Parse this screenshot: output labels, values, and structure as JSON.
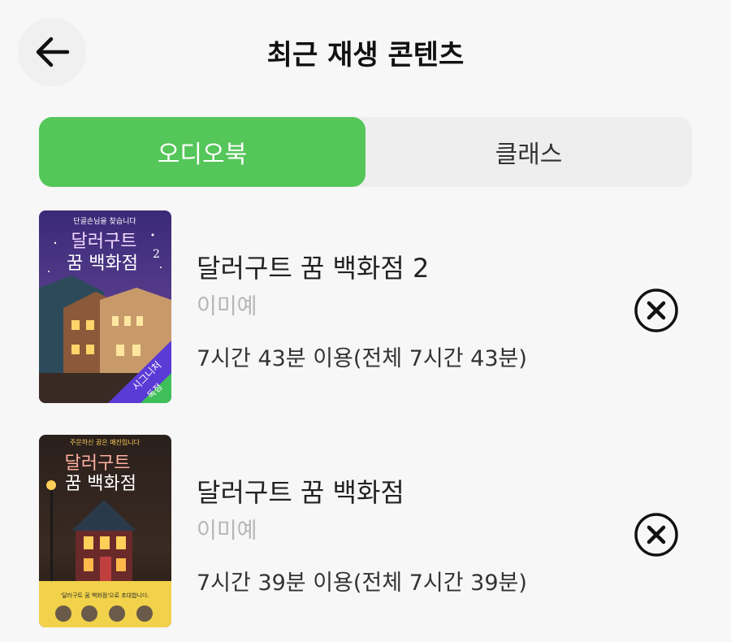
{
  "header": {
    "title": "최근 재생 콘텐츠",
    "back_icon": "arrow-left-icon"
  },
  "tabs": [
    {
      "label": "오디오북",
      "active": true
    },
    {
      "label": "클래스",
      "active": false
    }
  ],
  "colors": {
    "accent": "#55c659",
    "background": "#f7f7f7",
    "tab_bg": "#eeeeee"
  },
  "items": [
    {
      "title": "달러구트 꿈 백화점 2",
      "author": "이미예",
      "usage": "7시간 43분 이용(전체 7시간 43분)",
      "cover": {
        "tagline": "단골손님을 찾습니다",
        "title_line1": "달러구트",
        "title_line2": "꿈 백화점",
        "volume": "2",
        "badge_line1": "시그니처",
        "badge_line2": "독점"
      },
      "remove_icon": "close-circle-icon"
    },
    {
      "title": "달러구트 꿈 백화점",
      "author": "이미예",
      "usage": "7시간 39분 이용(전체 7시간 39분)",
      "cover": {
        "tagline": "주문하신 꿈은 매진입니다",
        "title_line1": "달러구트",
        "title_line2": "꿈 백화점",
        "banner": "'달러구트 꿈 백화점'으로 초대합니다."
      },
      "remove_icon": "close-circle-icon"
    }
  ]
}
